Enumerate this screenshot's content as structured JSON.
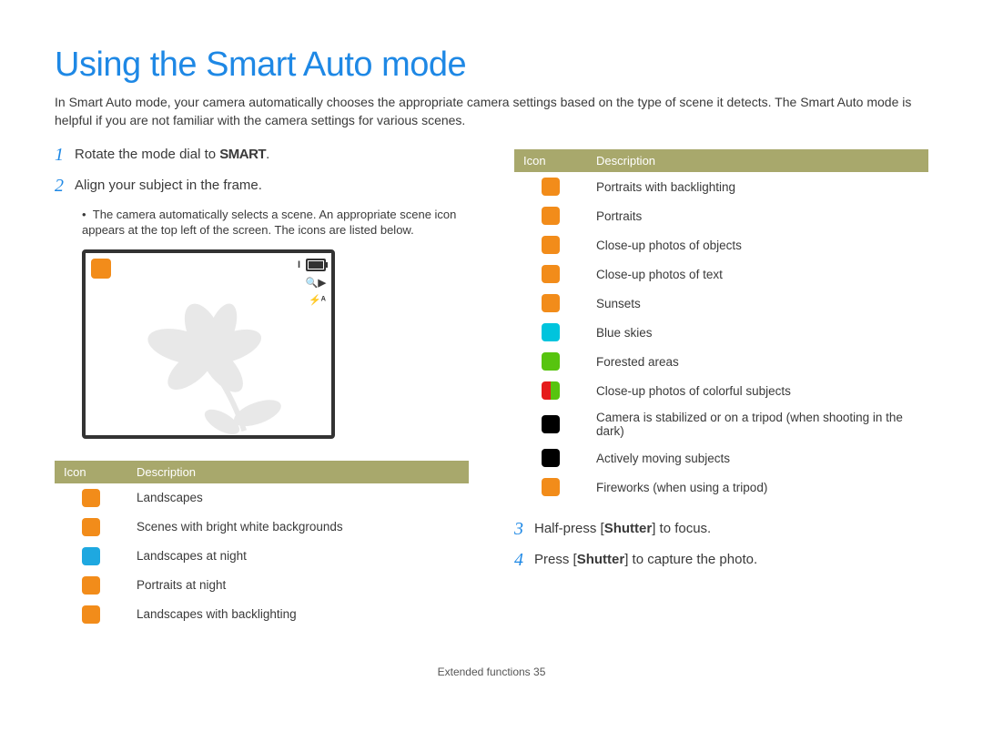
{
  "title": "Using the Smart Auto mode",
  "intro": "In Smart Auto mode, your camera automatically chooses the appropriate camera settings based on the type of scene it detects. The Smart Auto mode is helpful if you are not familiar with the camera settings for various scenes.",
  "steps": {
    "s1_num": "1",
    "s1_pre": "Rotate the mode dial to ",
    "s1_smart": "SMART",
    "s1_post": ".",
    "s2_num": "2",
    "s2_text": "Align your subject in the frame.",
    "s2_bullet": "The camera automatically selects a scene. An appropriate scene icon appears at the top left of the screen. The icons are listed below.",
    "s3_num": "3",
    "s3_pre": "Half-press [",
    "s3_bold": "Shutter",
    "s3_post": "] to focus.",
    "s4_num": "4",
    "s4_pre": "Press [",
    "s4_bold": "Shutter",
    "s4_post": "] to capture the photo."
  },
  "table_header": {
    "icon": "Icon",
    "desc": "Description"
  },
  "left_table": [
    {
      "icon_class": "ic-orange",
      "icon_name": "landscape-icon",
      "desc": "Landscapes"
    },
    {
      "icon_class": "ic-orange",
      "icon_name": "white-bg-icon",
      "desc": "Scenes with bright white backgrounds"
    },
    {
      "icon_class": "ic-blue",
      "icon_name": "night-landscape-icon",
      "desc": "Landscapes at night"
    },
    {
      "icon_class": "ic-orange",
      "icon_name": "night-portrait-icon",
      "desc": "Portraits at night"
    },
    {
      "icon_class": "ic-orange",
      "icon_name": "backlight-landscape-icon",
      "desc": "Landscapes with backlighting"
    }
  ],
  "right_table": [
    {
      "icon_class": "ic-orange",
      "icon_name": "backlight-portrait-icon",
      "desc": "Portraits with backlighting"
    },
    {
      "icon_class": "ic-orange",
      "icon_name": "portrait-icon",
      "desc": "Portraits"
    },
    {
      "icon_class": "ic-orange",
      "icon_name": "macro-object-icon",
      "desc": "Close-up photos of objects"
    },
    {
      "icon_class": "ic-orange",
      "icon_name": "macro-text-icon",
      "desc": "Close-up photos of text"
    },
    {
      "icon_class": "ic-orange",
      "icon_name": "sunset-icon",
      "desc": "Sunsets"
    },
    {
      "icon_class": "ic-cyan",
      "icon_name": "blue-sky-icon",
      "desc": "Blue skies"
    },
    {
      "icon_class": "ic-green",
      "icon_name": "forest-icon",
      "desc": "Forested areas"
    },
    {
      "icon_class": "ic-half",
      "icon_name": "macro-color-icon",
      "desc": "Close-up photos of colorful subjects"
    },
    {
      "icon_class": "ic-black",
      "icon_name": "tripod-icon",
      "desc": "Camera is stabilized or on a tripod (when shooting in the dark)"
    },
    {
      "icon_class": "ic-black",
      "icon_name": "action-icon",
      "desc": "Actively moving subjects"
    },
    {
      "icon_class": "ic-orange",
      "icon_name": "fireworks-icon",
      "desc": "Fireworks (when using a tripod)"
    }
  ],
  "lcd_indicators": {
    "topbar_text": "I",
    "zoom": "🔍▶",
    "flash": "⚡ᴬ"
  },
  "footer": {
    "section": "Extended functions ",
    "page": "35"
  }
}
